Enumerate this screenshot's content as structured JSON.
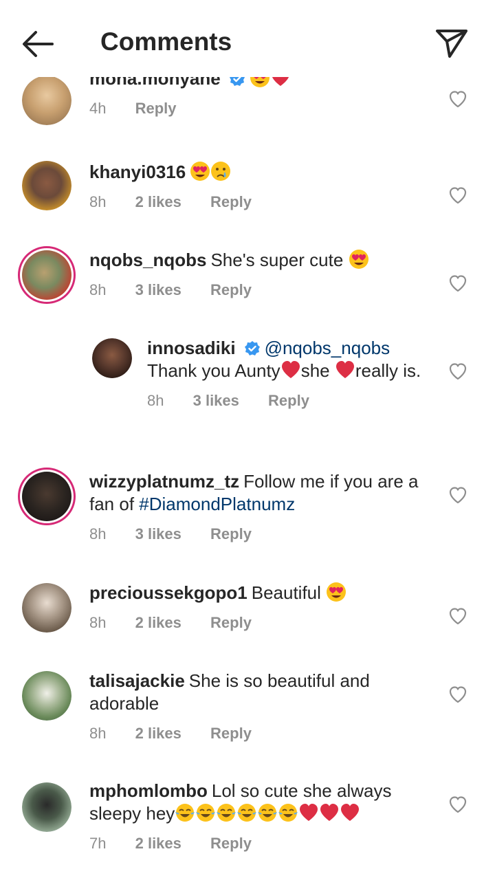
{
  "header": {
    "title": "Comments",
    "back_icon": "arrow-left-icon",
    "send_icon": "paper-plane-icon"
  },
  "reply_label": "Reply",
  "comments": [
    {
      "user": "mona.monyane",
      "verified": true,
      "text": "",
      "emoji": [
        "heart-eyes",
        "red-heart"
      ],
      "time": "4h",
      "likes": "",
      "avatar_color": "#c8a070"
    },
    {
      "user": "khanyi0316",
      "verified": false,
      "text": "",
      "emoji": [
        "heart-eyes",
        "crying-face"
      ],
      "time": "8h",
      "likes": "2 likes",
      "avatar_color": "#6b4a3a"
    },
    {
      "user": "nqobs_nqobs",
      "verified": false,
      "text": "She's super cute",
      "emoji": [
        "heart-eyes"
      ],
      "time": "8h",
      "likes": "3 likes",
      "avatar_color": "#7a8a60",
      "story": true
    },
    {
      "user": "innosadiki",
      "verified": true,
      "mention": "@nqobs_nqobs",
      "text_parts": [
        "Thank you Aunty",
        "she",
        "really",
        "is."
      ],
      "time": "8h",
      "likes": "3 likes",
      "avatar_color": "#5a3a2e",
      "reply": true
    },
    {
      "user": "wizzyplatnumz_tz",
      "verified": false,
      "text": "Follow me if you are a fan of",
      "hashtag": "#DiamondPlatnumz",
      "time": "8h",
      "likes": "3 likes",
      "avatar_color": "#2a2420",
      "story": true
    },
    {
      "user": "precioussekgopo1",
      "verified": false,
      "text": "Beautiful",
      "emoji": [
        "heart-eyes"
      ],
      "time": "8h",
      "likes": "2 likes",
      "avatar_color": "#8a7a6a"
    },
    {
      "user": "talisajackie",
      "verified": false,
      "text": "She is so beautiful and adorable",
      "time": "8h",
      "likes": "2 likes",
      "avatar_color": "#6a8a5a"
    },
    {
      "user": "mphomlombo",
      "verified": false,
      "text": "Lol so cute she always sleepy hey",
      "emoji": [
        "joy",
        "joy",
        "joy",
        "joy",
        "joy",
        "joy",
        "red-heart",
        "red-heart",
        "red-heart"
      ],
      "time": "7h",
      "likes": "2 likes",
      "avatar_color": "#4a5a4a"
    }
  ]
}
